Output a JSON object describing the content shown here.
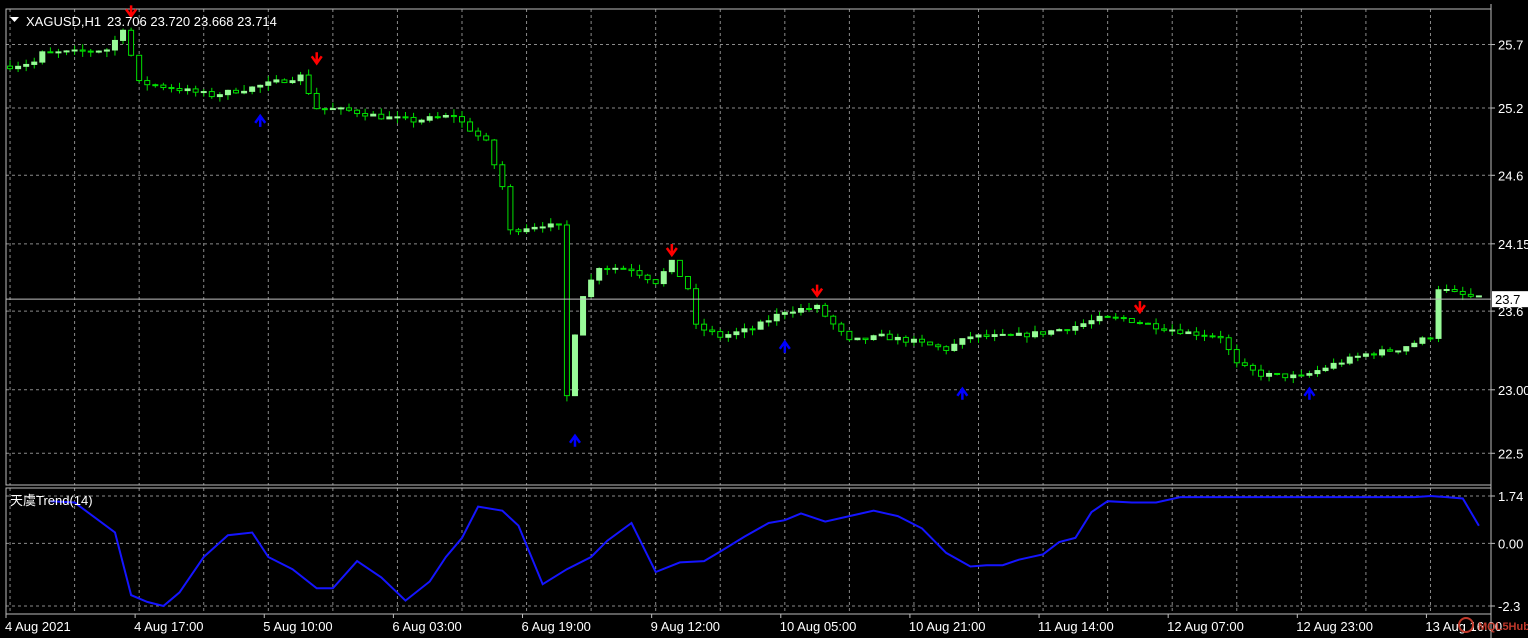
{
  "chart_data": [
    {
      "type": "candlestick",
      "header": {
        "symbol": "XAGUSD,H1",
        "ohlc_text": "23.706 23.720 23.668 23.714"
      },
      "price_axis": {
        "ylim": [
          22.25,
          26.0
        ],
        "ticks": [
          "25.7",
          "25.2",
          "24.6",
          "24.15",
          "23.6",
          "23.00",
          "22.5"
        ],
        "tick_values": [
          25.72,
          25.22,
          24.69,
          24.15,
          23.62,
          23.0,
          22.5
        ],
        "current_price_label": "23.7",
        "current_price": 23.714
      },
      "x_axis": {
        "ticks": [
          "4 Aug 2021",
          "4 Aug 17:00",
          "5 Aug 10:00",
          "6 Aug 03:00",
          "6 Aug 19:00",
          "9 Aug 12:00",
          "10 Aug 05:00",
          "10 Aug 21:00",
          "11 Aug 14:00",
          "12 Aug 07:00",
          "12 Aug 23:00",
          "13 Aug 16:00"
        ],
        "tick_bar_index": [
          0,
          16,
          32,
          48,
          64,
          80,
          96,
          112,
          128,
          144,
          160,
          176
        ]
      },
      "close_path": [
        [
          0,
          25.55
        ],
        [
          3,
          25.58
        ],
        [
          4,
          25.65
        ],
        [
          8,
          25.66
        ],
        [
          12,
          25.68
        ],
        [
          13,
          25.75
        ],
        [
          14,
          25.85
        ],
        [
          16,
          25.42
        ],
        [
          20,
          25.38
        ],
        [
          25,
          25.32
        ],
        [
          30,
          25.38
        ],
        [
          36,
          25.47
        ],
        [
          38,
          25.22
        ],
        [
          42,
          25.2
        ],
        [
          46,
          25.15
        ],
        [
          50,
          25.12
        ],
        [
          55,
          25.16
        ],
        [
          57,
          25.05
        ],
        [
          59,
          24.95
        ],
        [
          61,
          24.6
        ],
        [
          62,
          24.25
        ],
        [
          64,
          24.28
        ],
        [
          66,
          24.3
        ],
        [
          68,
          24.28
        ],
        [
          69,
          22.95
        ],
        [
          70,
          23.45
        ],
        [
          71,
          23.75
        ],
        [
          73,
          23.97
        ],
        [
          77,
          23.95
        ],
        [
          80,
          23.85
        ],
        [
          82,
          24.0
        ],
        [
          84,
          23.8
        ],
        [
          85,
          23.5
        ],
        [
          88,
          23.42
        ],
        [
          92,
          23.48
        ],
        [
          96,
          23.62
        ],
        [
          100,
          23.65
        ],
        [
          104,
          23.38
        ],
        [
          108,
          23.42
        ],
        [
          112,
          23.38
        ],
        [
          116,
          23.32
        ],
        [
          119,
          23.42
        ],
        [
          124,
          23.42
        ],
        [
          128,
          23.45
        ],
        [
          132,
          23.5
        ],
        [
          135,
          23.56
        ],
        [
          138,
          23.56
        ],
        [
          142,
          23.5
        ],
        [
          146,
          23.45
        ],
        [
          150,
          23.42
        ],
        [
          152,
          23.2
        ],
        [
          155,
          23.12
        ],
        [
          160,
          23.1
        ],
        [
          164,
          23.2
        ],
        [
          168,
          23.28
        ],
        [
          172,
          23.32
        ],
        [
          176,
          23.42
        ],
        [
          177,
          23.8
        ],
        [
          179,
          23.76
        ],
        [
          182,
          23.72
        ]
      ],
      "signals": {
        "sell": [
          [
            15,
            25.95
          ],
          [
            38,
            25.58
          ],
          [
            82,
            24.07
          ],
          [
            100,
            23.75
          ],
          [
            140,
            23.62
          ]
        ],
        "buy": [
          [
            31,
            25.15
          ],
          [
            70,
            22.63
          ],
          [
            96,
            23.37
          ],
          [
            118,
            23.0
          ],
          [
            161,
            23.0
          ]
        ]
      }
    },
    {
      "type": "line",
      "title": "天虞Trend(14)",
      "ylim": [
        -2.3,
        1.74
      ],
      "ticks": [
        "1.74",
        "0.00",
        "-2.3"
      ],
      "tick_values": [
        1.74,
        0.0,
        -2.3
      ],
      "x": [
        5,
        8,
        13,
        15,
        17,
        19,
        21,
        24,
        27,
        30,
        32,
        35,
        38,
        40,
        43,
        46,
        49,
        52,
        54,
        56,
        58,
        61,
        63,
        66,
        69,
        72,
        74,
        77,
        80,
        83,
        86,
        88,
        91,
        94,
        96,
        98,
        101,
        104,
        107,
        110,
        113,
        116,
        119,
        121,
        123,
        125,
        128,
        130,
        132,
        134,
        136,
        139,
        142,
        145,
        148,
        151,
        154,
        157,
        160,
        163,
        166,
        169,
        172,
        174,
        176,
        178,
        180,
        182
      ],
      "y": [
        1.55,
        1.5,
        0.4,
        -1.9,
        -2.15,
        -2.3,
        -1.8,
        -0.5,
        0.3,
        0.4,
        -0.5,
        -0.95,
        -1.65,
        -1.65,
        -0.65,
        -1.25,
        -2.1,
        -1.4,
        -0.5,
        0.2,
        1.35,
        1.2,
        0.65,
        -1.5,
        -0.95,
        -0.5,
        0.1,
        0.75,
        -1.05,
        -0.7,
        -0.65,
        -0.3,
        0.25,
        0.75,
        0.85,
        1.1,
        0.8,
        1.0,
        1.2,
        1.0,
        0.55,
        -0.35,
        -0.85,
        -0.8,
        -0.8,
        -0.6,
        -0.4,
        0.05,
        0.2,
        1.15,
        1.55,
        1.5,
        1.5,
        1.7,
        1.7,
        1.7,
        1.7,
        1.7,
        1.7,
        1.7,
        1.7,
        1.7,
        1.7,
        1.7,
        1.74,
        1.7,
        1.65,
        0.65
      ],
      "line_color": "#1515ff"
    }
  ],
  "colors": {
    "background": "#000000",
    "grid": "#8a8a8a",
    "bull_candle": "#98fb98",
    "bear_candle": "#00e000",
    "buy_arrow": "#0000ff",
    "sell_arrow": "#ff0000",
    "indicator_line": "#1515ff",
    "axis_text": "#ffffff"
  },
  "watermark": "MQL5Hub"
}
